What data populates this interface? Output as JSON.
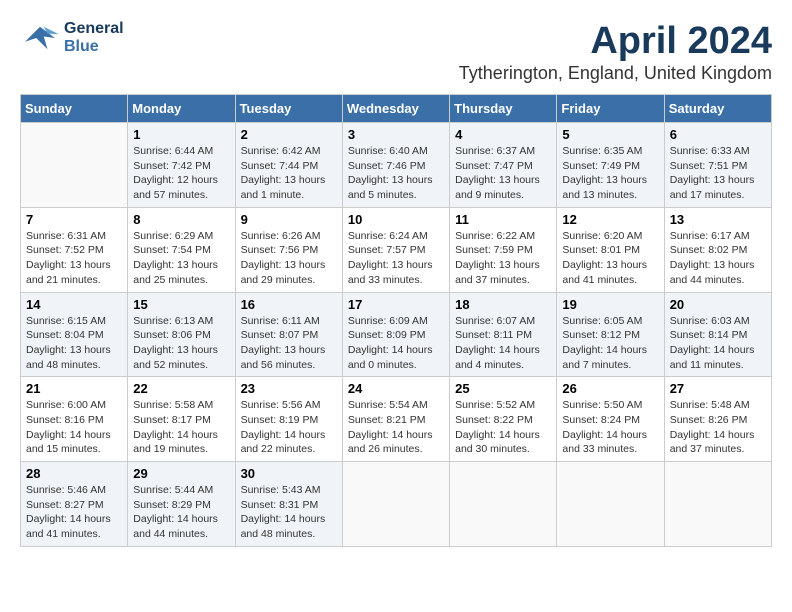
{
  "header": {
    "logo_line1": "General",
    "logo_line2": "Blue",
    "month_year": "April 2024",
    "location": "Tytherington, England, United Kingdom"
  },
  "weekdays": [
    "Sunday",
    "Monday",
    "Tuesday",
    "Wednesday",
    "Thursday",
    "Friday",
    "Saturday"
  ],
  "weeks": [
    [
      {
        "day": "",
        "sunrise": "",
        "sunset": "",
        "daylight": ""
      },
      {
        "day": "1",
        "sunrise": "Sunrise: 6:44 AM",
        "sunset": "Sunset: 7:42 PM",
        "daylight": "Daylight: 12 hours and 57 minutes."
      },
      {
        "day": "2",
        "sunrise": "Sunrise: 6:42 AM",
        "sunset": "Sunset: 7:44 PM",
        "daylight": "Daylight: 13 hours and 1 minute."
      },
      {
        "day": "3",
        "sunrise": "Sunrise: 6:40 AM",
        "sunset": "Sunset: 7:46 PM",
        "daylight": "Daylight: 13 hours and 5 minutes."
      },
      {
        "day": "4",
        "sunrise": "Sunrise: 6:37 AM",
        "sunset": "Sunset: 7:47 PM",
        "daylight": "Daylight: 13 hours and 9 minutes."
      },
      {
        "day": "5",
        "sunrise": "Sunrise: 6:35 AM",
        "sunset": "Sunset: 7:49 PM",
        "daylight": "Daylight: 13 hours and 13 minutes."
      },
      {
        "day": "6",
        "sunrise": "Sunrise: 6:33 AM",
        "sunset": "Sunset: 7:51 PM",
        "daylight": "Daylight: 13 hours and 17 minutes."
      }
    ],
    [
      {
        "day": "7",
        "sunrise": "Sunrise: 6:31 AM",
        "sunset": "Sunset: 7:52 PM",
        "daylight": "Daylight: 13 hours and 21 minutes."
      },
      {
        "day": "8",
        "sunrise": "Sunrise: 6:29 AM",
        "sunset": "Sunset: 7:54 PM",
        "daylight": "Daylight: 13 hours and 25 minutes."
      },
      {
        "day": "9",
        "sunrise": "Sunrise: 6:26 AM",
        "sunset": "Sunset: 7:56 PM",
        "daylight": "Daylight: 13 hours and 29 minutes."
      },
      {
        "day": "10",
        "sunrise": "Sunrise: 6:24 AM",
        "sunset": "Sunset: 7:57 PM",
        "daylight": "Daylight: 13 hours and 33 minutes."
      },
      {
        "day": "11",
        "sunrise": "Sunrise: 6:22 AM",
        "sunset": "Sunset: 7:59 PM",
        "daylight": "Daylight: 13 hours and 37 minutes."
      },
      {
        "day": "12",
        "sunrise": "Sunrise: 6:20 AM",
        "sunset": "Sunset: 8:01 PM",
        "daylight": "Daylight: 13 hours and 41 minutes."
      },
      {
        "day": "13",
        "sunrise": "Sunrise: 6:17 AM",
        "sunset": "Sunset: 8:02 PM",
        "daylight": "Daylight: 13 hours and 44 minutes."
      }
    ],
    [
      {
        "day": "14",
        "sunrise": "Sunrise: 6:15 AM",
        "sunset": "Sunset: 8:04 PM",
        "daylight": "Daylight: 13 hours and 48 minutes."
      },
      {
        "day": "15",
        "sunrise": "Sunrise: 6:13 AM",
        "sunset": "Sunset: 8:06 PM",
        "daylight": "Daylight: 13 hours and 52 minutes."
      },
      {
        "day": "16",
        "sunrise": "Sunrise: 6:11 AM",
        "sunset": "Sunset: 8:07 PM",
        "daylight": "Daylight: 13 hours and 56 minutes."
      },
      {
        "day": "17",
        "sunrise": "Sunrise: 6:09 AM",
        "sunset": "Sunset: 8:09 PM",
        "daylight": "Daylight: 14 hours and 0 minutes."
      },
      {
        "day": "18",
        "sunrise": "Sunrise: 6:07 AM",
        "sunset": "Sunset: 8:11 PM",
        "daylight": "Daylight: 14 hours and 4 minutes."
      },
      {
        "day": "19",
        "sunrise": "Sunrise: 6:05 AM",
        "sunset": "Sunset: 8:12 PM",
        "daylight": "Daylight: 14 hours and 7 minutes."
      },
      {
        "day": "20",
        "sunrise": "Sunrise: 6:03 AM",
        "sunset": "Sunset: 8:14 PM",
        "daylight": "Daylight: 14 hours and 11 minutes."
      }
    ],
    [
      {
        "day": "21",
        "sunrise": "Sunrise: 6:00 AM",
        "sunset": "Sunset: 8:16 PM",
        "daylight": "Daylight: 14 hours and 15 minutes."
      },
      {
        "day": "22",
        "sunrise": "Sunrise: 5:58 AM",
        "sunset": "Sunset: 8:17 PM",
        "daylight": "Daylight: 14 hours and 19 minutes."
      },
      {
        "day": "23",
        "sunrise": "Sunrise: 5:56 AM",
        "sunset": "Sunset: 8:19 PM",
        "daylight": "Daylight: 14 hours and 22 minutes."
      },
      {
        "day": "24",
        "sunrise": "Sunrise: 5:54 AM",
        "sunset": "Sunset: 8:21 PM",
        "daylight": "Daylight: 14 hours and 26 minutes."
      },
      {
        "day": "25",
        "sunrise": "Sunrise: 5:52 AM",
        "sunset": "Sunset: 8:22 PM",
        "daylight": "Daylight: 14 hours and 30 minutes."
      },
      {
        "day": "26",
        "sunrise": "Sunrise: 5:50 AM",
        "sunset": "Sunset: 8:24 PM",
        "daylight": "Daylight: 14 hours and 33 minutes."
      },
      {
        "day": "27",
        "sunrise": "Sunrise: 5:48 AM",
        "sunset": "Sunset: 8:26 PM",
        "daylight": "Daylight: 14 hours and 37 minutes."
      }
    ],
    [
      {
        "day": "28",
        "sunrise": "Sunrise: 5:46 AM",
        "sunset": "Sunset: 8:27 PM",
        "daylight": "Daylight: 14 hours and 41 minutes."
      },
      {
        "day": "29",
        "sunrise": "Sunrise: 5:44 AM",
        "sunset": "Sunset: 8:29 PM",
        "daylight": "Daylight: 14 hours and 44 minutes."
      },
      {
        "day": "30",
        "sunrise": "Sunrise: 5:43 AM",
        "sunset": "Sunset: 8:31 PM",
        "daylight": "Daylight: 14 hours and 48 minutes."
      },
      {
        "day": "",
        "sunrise": "",
        "sunset": "",
        "daylight": ""
      },
      {
        "day": "",
        "sunrise": "",
        "sunset": "",
        "daylight": ""
      },
      {
        "day": "",
        "sunrise": "",
        "sunset": "",
        "daylight": ""
      },
      {
        "day": "",
        "sunrise": "",
        "sunset": "",
        "daylight": ""
      }
    ]
  ]
}
